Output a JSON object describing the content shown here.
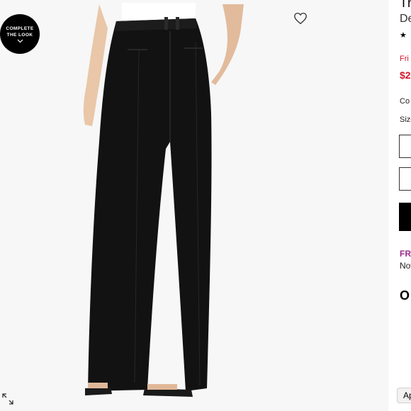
{
  "image": {
    "complete_look": {
      "line1": "COMPLETE",
      "line2": "THE LOOK"
    },
    "icons": {
      "favorite": "heart-icon",
      "expand": "expand-icon",
      "chevron": "chevron-down-icon"
    }
  },
  "product": {
    "title": "Th",
    "designer": "De",
    "rating": "★ ★",
    "promo": "Fri",
    "price": "$2",
    "color_label": "Co",
    "size_label": "Size",
    "shipping": "FRI",
    "shipping_note": "Nov",
    "other_heading": "O"
  },
  "chat": {
    "label": "Ap"
  },
  "colors": {
    "accent_red": "#d2172a",
    "accent_purple": "#9b2d8c",
    "black": "#000000"
  }
}
